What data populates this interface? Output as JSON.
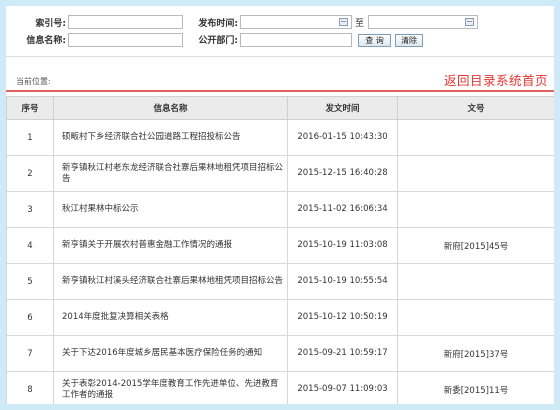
{
  "search": {
    "index_label": "索引号:",
    "publish_time_label": "发布时间:",
    "to_label": "至",
    "info_name_label": "信息名称:",
    "public_dept_label": "公开部门:",
    "index_value": "",
    "date_from_value": "",
    "date_to_value": "",
    "info_name_value": "",
    "dept_value": "",
    "query_button": "查 询",
    "clear_button": "清除"
  },
  "location": {
    "label": "当前位置:",
    "back_link": "返回目录系统首页"
  },
  "table": {
    "headers": [
      "序号",
      "信息名称",
      "发文时间",
      "文号"
    ],
    "rows": [
      {
        "no": "1",
        "name": "硕畈村下乡经济联合社公园道路工程招投标公告",
        "time": "2016-01-15 10:43:30",
        "doc": ""
      },
      {
        "no": "2",
        "name": "新亨镇秋江村老东龙经济联合社寨后果林地租凭项目招标公告",
        "time": "2015-12-15 16:40:28",
        "doc": ""
      },
      {
        "no": "3",
        "name": "秋江村果林中标公示",
        "time": "2015-11-02 16:06:34",
        "doc": ""
      },
      {
        "no": "4",
        "name": "新亨镇关于开展农村普惠金融工作情况的通报",
        "time": "2015-10-19 11:03:08",
        "doc": "新府[2015]45号"
      },
      {
        "no": "5",
        "name": "新亨镇秋江村溪头经济联合社寨后果林地租凭项目招标公告",
        "time": "2015-10-19 10:55:54",
        "doc": ""
      },
      {
        "no": "6",
        "name": "2014年度批复决算相关表格",
        "time": "2015-10-12 10:50:19",
        "doc": ""
      },
      {
        "no": "7",
        "name": "关于下达2016年度城乡居民基本医疗保险任务的通知",
        "time": "2015-09-21 10:59:17",
        "doc": "新府[2015]37号"
      },
      {
        "no": "8",
        "name": "关于表彰2014-2015学年度教育工作先进单位、先进教育工作者的通报",
        "time": "2015-09-07 11:09:03",
        "doc": "新委[2015]11号"
      }
    ]
  }
}
